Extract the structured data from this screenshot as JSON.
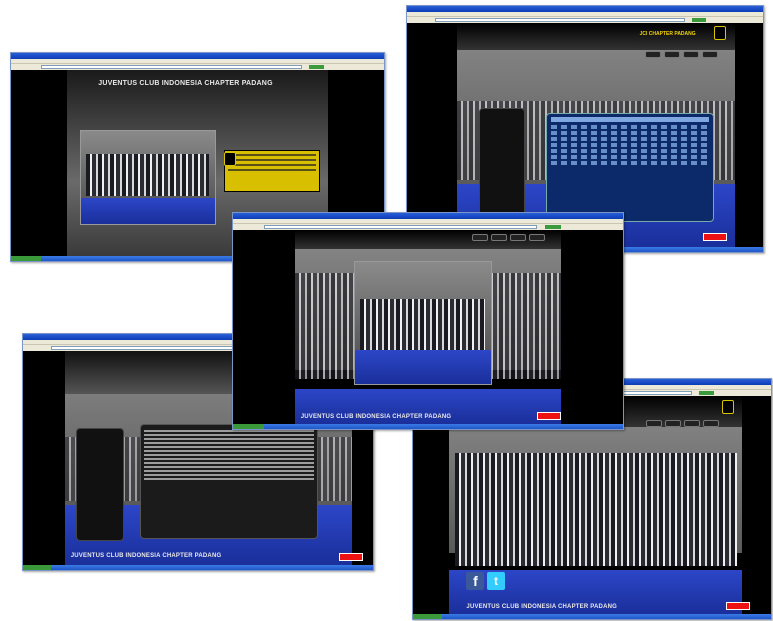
{
  "screens": {
    "home": {
      "title": "JUVENTUS CLUB INDONESIA CHAPTER PADANG"
    },
    "fixtures": {
      "header": "JCI CHAPTER PADANG"
    },
    "gallery": {
      "footer": "JUVENTUS CLUB INDONESIA CHAPTER PADANG"
    },
    "about": {
      "footer": "JUVENTUS CLUB INDONESIA CHAPTER PADANG"
    },
    "social": {
      "footer": "JUVENTUS CLUB INDONESIA CHAPTER PADANG",
      "facebook_icon": "facebook-icon",
      "twitter_icon": "twitter-icon"
    }
  },
  "colors": {
    "accent_yellow": "#f5d400",
    "floor_blue": "#2c46c8",
    "xp_blue": "#0a3cb5"
  }
}
